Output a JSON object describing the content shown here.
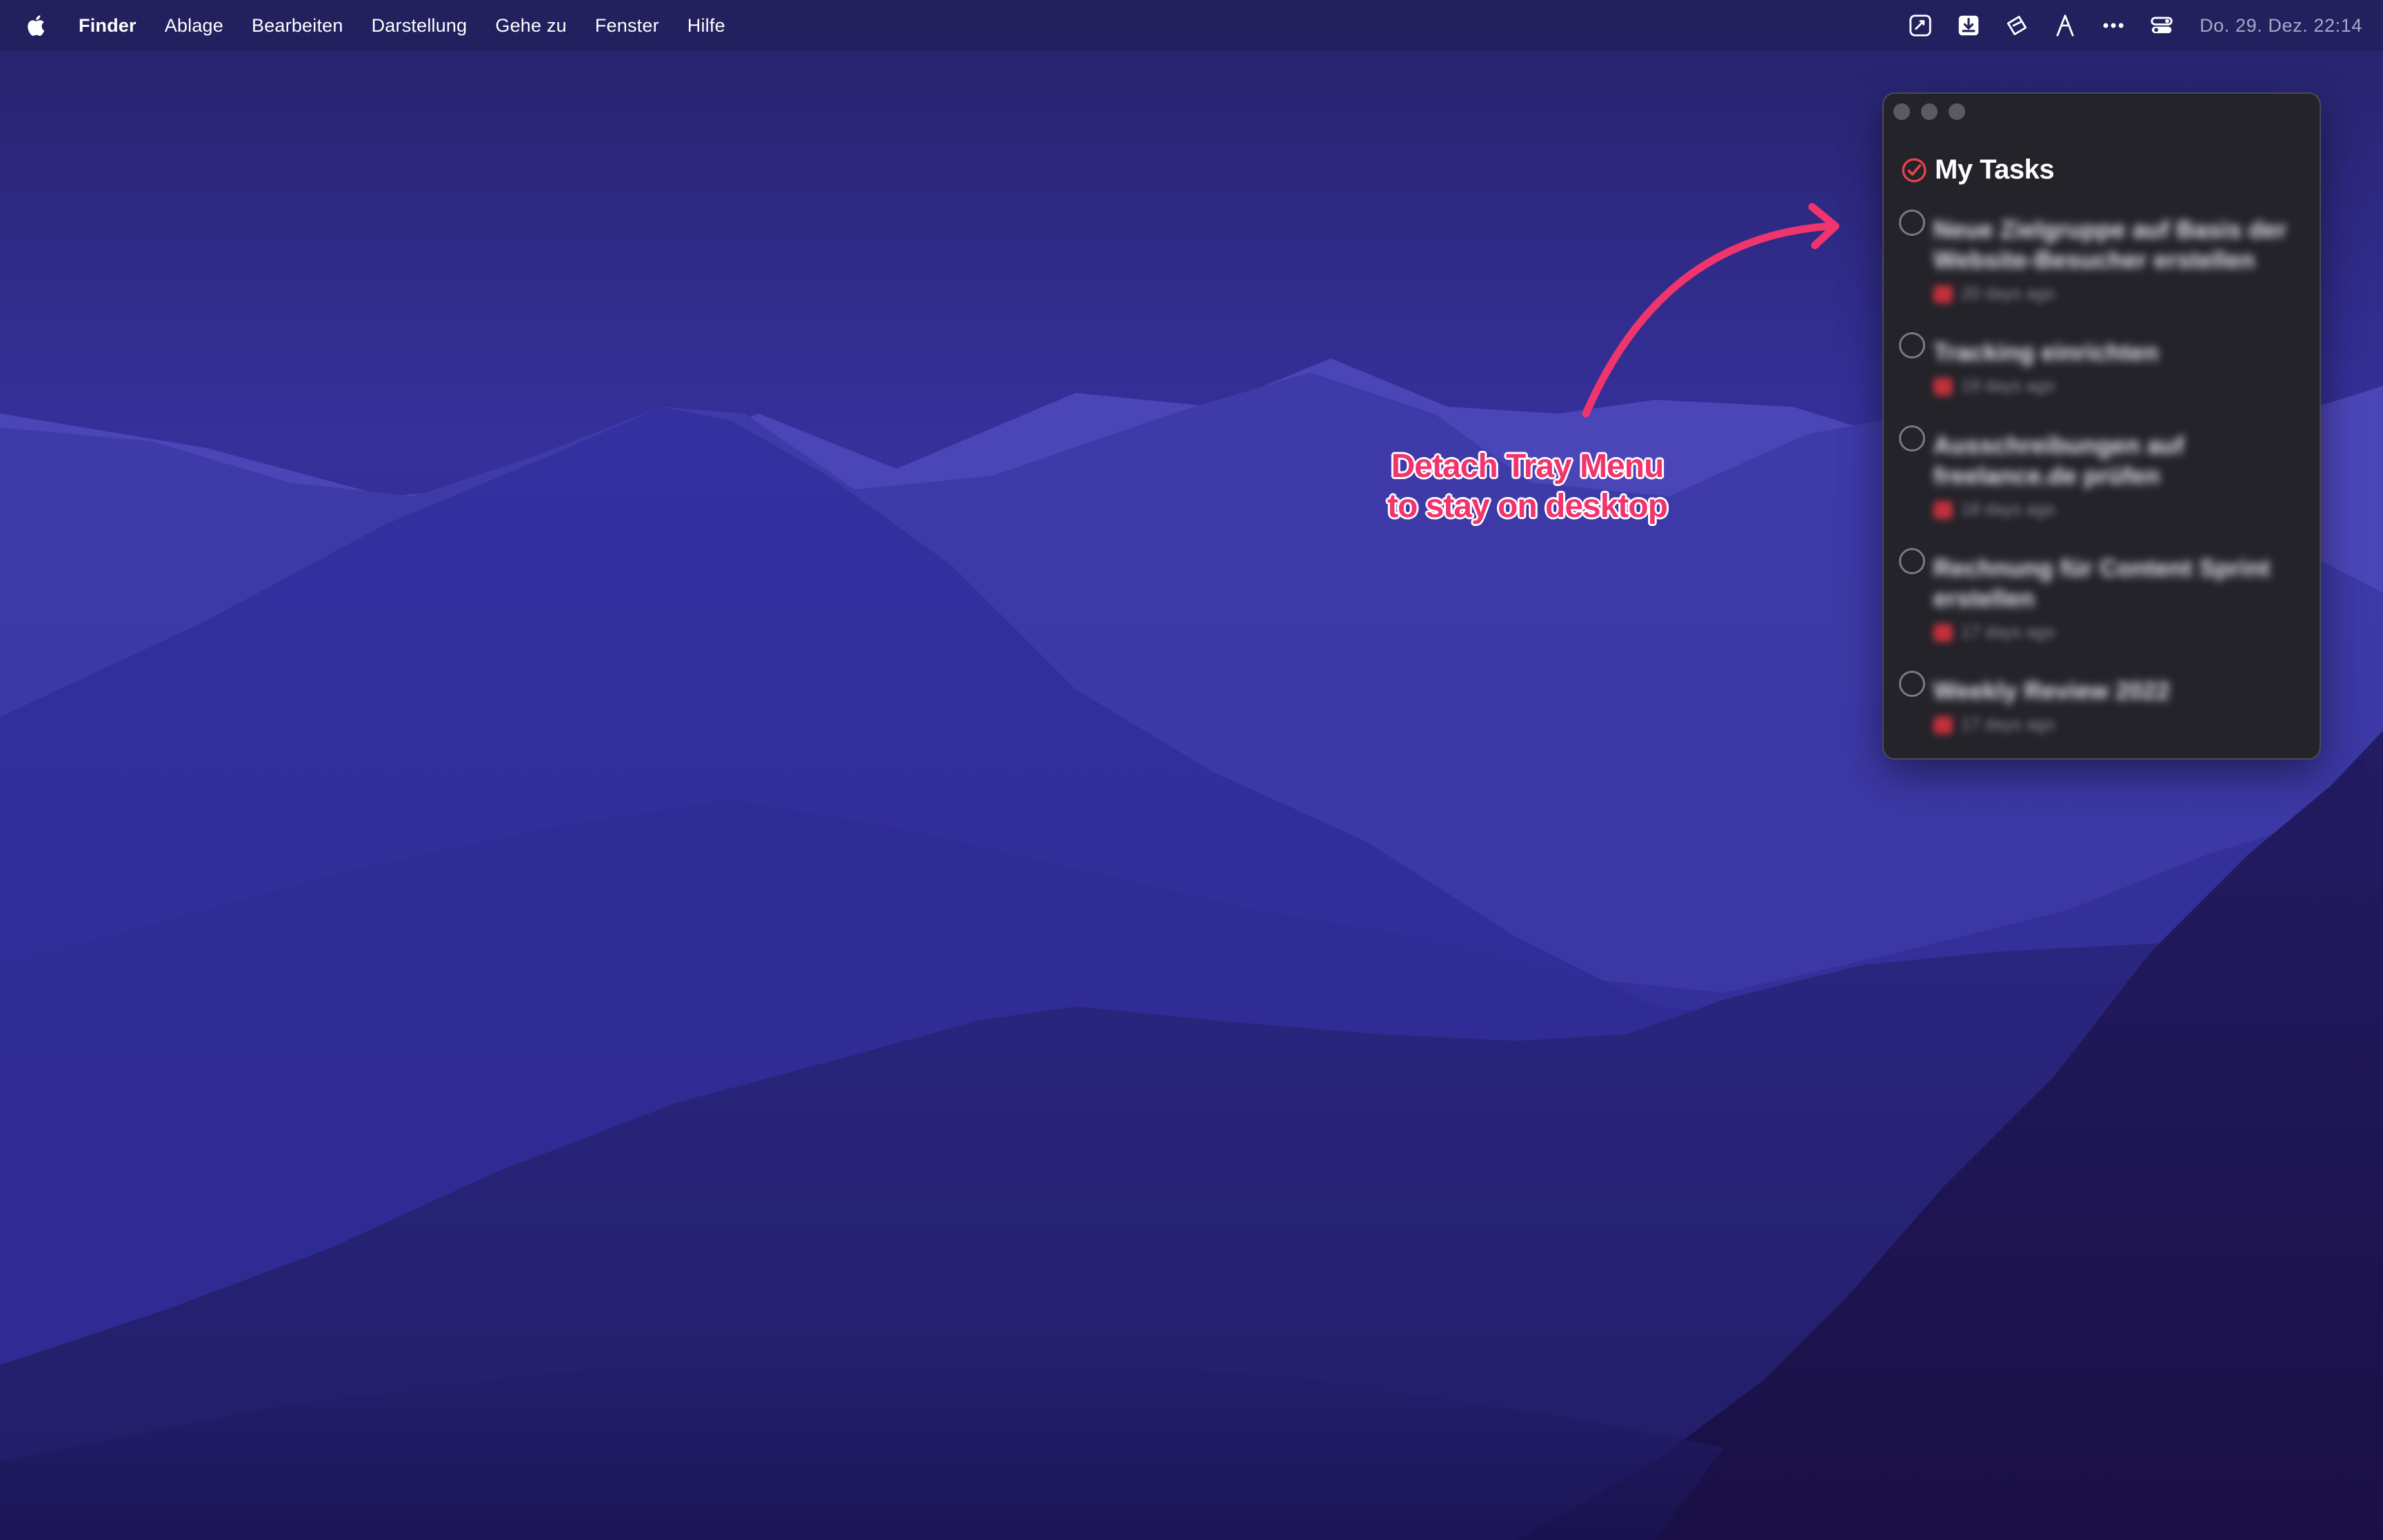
{
  "menubar": {
    "apple_icon": "apple-logo-icon",
    "app_name": "Finder",
    "items": [
      "Ablage",
      "Bearbeiten",
      "Darstellung",
      "Gehe zu",
      "Fenster",
      "Hilfe"
    ],
    "status_icons": [
      "sync-icon",
      "download-tray-icon",
      "magic-wand-icon",
      "triangle-logo-icon",
      "more-dots-icon",
      "control-center-icon"
    ],
    "clock": "Do. 29. Dez.  22:14"
  },
  "annotation": {
    "line1": "Detach Tray Menu",
    "line2": "to stay on desktop",
    "color": "#f0346e"
  },
  "tasks_window": {
    "title": "My Tasks",
    "title_icon": "checkbox-checked-icon",
    "accent": "#e8424f",
    "tasks": [
      {
        "title": "Neue Zielgruppe auf Basis der Website-Besucher erstellen",
        "due": "20 days ago"
      },
      {
        "title": "Tracking einrichten",
        "due": "19 days ago"
      },
      {
        "title": "Ausschreibungen auf freelance.de prüfen",
        "due": "18 days ago"
      },
      {
        "title": "Rechnung für Content Sprint erstellen",
        "due": "17 days ago"
      },
      {
        "title": "Weekly Review 2022",
        "due": "17 days ago"
      }
    ]
  },
  "colors": {
    "menubar_bg": "#22215c",
    "window_bg": "#24232a",
    "wallpaper_sky": "#2d2a7a"
  }
}
